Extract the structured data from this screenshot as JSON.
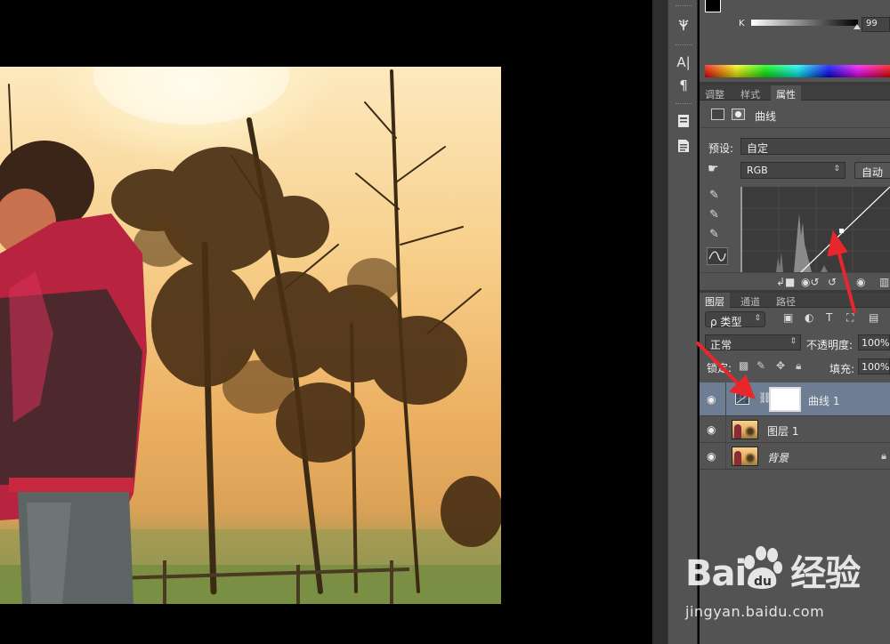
{
  "colors": {
    "panel_bg": "#535353",
    "panel_dark": "#3f3f3f",
    "selected_layer": "#6e7d93",
    "annotation_red": "#e8272c"
  },
  "color_panel": {
    "channel_label": "K",
    "k_value": "99"
  },
  "top_tabs": [
    {
      "label": "调整",
      "active": false
    },
    {
      "label": "样式",
      "active": false
    },
    {
      "label": "属性",
      "active": true
    }
  ],
  "properties": {
    "title": "曲线",
    "preset_label": "预设:",
    "preset_value": "自定",
    "channel_value": "RGB",
    "auto_button": "自动"
  },
  "tool_strip": {
    "icons": [
      "histogram-icon",
      "character-icon",
      "paragraph-icon",
      "notes-icon",
      "info-icon"
    ],
    "char_glyph": "A|",
    "para_glyph": "¶"
  },
  "layers_tabs": [
    {
      "label": "图层",
      "active": true
    },
    {
      "label": "通道",
      "active": false
    },
    {
      "label": "路径",
      "active": false
    }
  ],
  "layers_panel": {
    "filter_label": "ρ 类型",
    "blend_mode": "正常",
    "opacity_label": "不透明度:",
    "opacity_value": "100%",
    "lock_label": "锁定:",
    "fill_label": "填充:",
    "fill_value": "100%",
    "layers": [
      {
        "name": "曲线 1",
        "type": "adjustment",
        "selected": true
      },
      {
        "name": "图层 1",
        "type": "pixel",
        "selected": false
      },
      {
        "name": "背景",
        "type": "background",
        "selected": false,
        "locked": true
      }
    ]
  },
  "watermark": {
    "logo_left": "Bai",
    "logo_right": "经验",
    "url": "jingyan.baidu.com"
  }
}
